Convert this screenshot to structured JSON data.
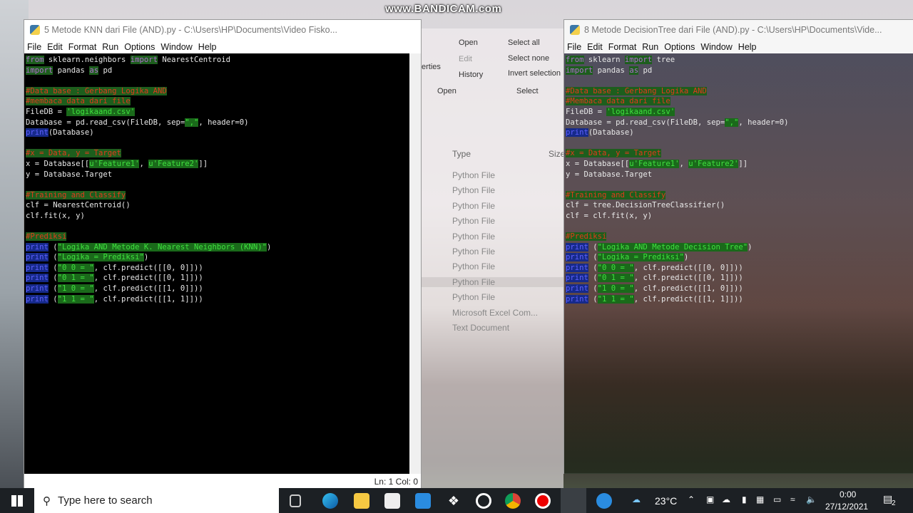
{
  "watermark": "www.BANDICAM.com",
  "left": {
    "title": "5 Metode KNN dari File (AND).py - C:\\Users\\HP\\Documents\\Video Fisko...",
    "menu": [
      "File",
      "Edit",
      "Format",
      "Run",
      "Options",
      "Window",
      "Help"
    ],
    "status": "Ln: 1  Col: 0",
    "code": [
      [
        [
          "kw",
          "from"
        ],
        [
          "p",
          " sklearn.neighbors "
        ],
        [
          "kw",
          "import"
        ],
        [
          "p",
          " NearestCentroid"
        ]
      ],
      [
        [
          "kw",
          "import"
        ],
        [
          "p",
          " pandas "
        ],
        [
          "kw",
          "as"
        ],
        [
          "p",
          " pd"
        ]
      ],
      [],
      [
        [
          "cm",
          "#Data base : Gerbang Logika AND"
        ]
      ],
      [
        [
          "cm",
          "#membaca data dari file"
        ]
      ],
      [
        [
          "p",
          "FileDB = "
        ],
        [
          "str",
          "'logikaand.csv'"
        ]
      ],
      [
        [
          "p",
          "Database = pd.read_csv(FileDB, sep="
        ],
        [
          "str",
          "\",\""
        ],
        [
          "p",
          ", header=0)"
        ]
      ],
      [
        [
          "bi",
          "print"
        ],
        [
          "p",
          "(Database)"
        ]
      ],
      [],
      [
        [
          "cm",
          "#x = Data, y = Target"
        ]
      ],
      [
        [
          "p",
          "x = Database[["
        ],
        [
          "str",
          "u'Feature1'"
        ],
        [
          "p",
          ", "
        ],
        [
          "str",
          "u'Feature2'"
        ],
        [
          "p",
          "]]"
        ]
      ],
      [
        [
          "p",
          "y = Database.Target"
        ]
      ],
      [],
      [
        [
          "cm",
          "#Training and Classify"
        ]
      ],
      [
        [
          "p",
          "clf = NearestCentroid()"
        ]
      ],
      [
        [
          "p",
          "clf.fit(x, y)"
        ]
      ],
      [],
      [
        [
          "cm",
          "#Prediksi"
        ]
      ],
      [
        [
          "bi",
          "print"
        ],
        [
          "p",
          " ("
        ],
        [
          "str",
          "\"Logika AND Metode K. Nearest Neighbors (KNN)\""
        ],
        [
          "p",
          ")"
        ]
      ],
      [
        [
          "bi",
          "print"
        ],
        [
          "p",
          " ("
        ],
        [
          "str",
          "\"Logika = Prediksi\""
        ],
        [
          "p",
          ")"
        ]
      ],
      [
        [
          "bi",
          "print"
        ],
        [
          "p",
          " ("
        ],
        [
          "str",
          "\"0 0 = \""
        ],
        [
          "p",
          ", clf.predict([[0, 0]]))"
        ]
      ],
      [
        [
          "bi",
          "print"
        ],
        [
          "p",
          " ("
        ],
        [
          "str",
          "\"0 1 = \""
        ],
        [
          "p",
          ", clf.predict([[0, 1]]))"
        ]
      ],
      [
        [
          "bi",
          "print"
        ],
        [
          "p",
          " ("
        ],
        [
          "str",
          "\"1 0 = \""
        ],
        [
          "p",
          ", clf.predict([[1, 0]]))"
        ]
      ],
      [
        [
          "bi",
          "print"
        ],
        [
          "p",
          " ("
        ],
        [
          "str",
          "\"1 1 = \""
        ],
        [
          "p",
          ", clf.predict([[1, 1]]))"
        ]
      ]
    ]
  },
  "right": {
    "title": "8 Metode DecisionTree dari File (AND).py - C:\\Users\\HP\\Documents\\Vide...",
    "menu": [
      "File",
      "Edit",
      "Format",
      "Run",
      "Options",
      "Window",
      "Help"
    ],
    "code": [
      [
        [
          "kw",
          "from"
        ],
        [
          "p",
          " sklearn "
        ],
        [
          "kw",
          "import"
        ],
        [
          "p",
          " tree"
        ]
      ],
      [
        [
          "kw",
          "import"
        ],
        [
          "p",
          " pandas "
        ],
        [
          "kw",
          "as"
        ],
        [
          "p",
          " pd"
        ]
      ],
      [],
      [
        [
          "cm",
          "#Data base : Gerbang Logika AND"
        ]
      ],
      [
        [
          "cm",
          "#Membaca data dari file"
        ]
      ],
      [
        [
          "p",
          "FileDB = "
        ],
        [
          "str",
          "'logikaand.csv'"
        ]
      ],
      [
        [
          "p",
          "Database = pd.read_csv(FileDB, sep="
        ],
        [
          "str",
          "\",\""
        ],
        [
          "p",
          ", header=0)"
        ]
      ],
      [
        [
          "bi",
          "print"
        ],
        [
          "p",
          "(Database)"
        ]
      ],
      [],
      [
        [
          "cm",
          "#x = Data, y = Target"
        ]
      ],
      [
        [
          "p",
          "x = Database[["
        ],
        [
          "str",
          "u'Feature1'"
        ],
        [
          "p",
          ", "
        ],
        [
          "str",
          "u'Feature2'"
        ],
        [
          "p",
          "]]"
        ]
      ],
      [
        [
          "p",
          "y = Database.Target"
        ]
      ],
      [],
      [
        [
          "cm",
          "#Training and Classify"
        ]
      ],
      [
        [
          "p",
          "clf = tree.DecisionTreeClassifier()"
        ]
      ],
      [
        [
          "p",
          "clf = clf.fit(x, y)"
        ]
      ],
      [],
      [
        [
          "cm",
          "#Prediksi"
        ]
      ],
      [
        [
          "bi",
          "print"
        ],
        [
          "p",
          " ("
        ],
        [
          "str",
          "\"Logika AND Metode Decision Tree\""
        ],
        [
          "p",
          ")"
        ]
      ],
      [
        [
          "bi",
          "print"
        ],
        [
          "p",
          " ("
        ],
        [
          "str",
          "\"Logika = Prediksi\""
        ],
        [
          "p",
          ")"
        ]
      ],
      [
        [
          "bi",
          "print"
        ],
        [
          "p",
          " ("
        ],
        [
          "str",
          "\"0 0 = \""
        ],
        [
          "p",
          ", clf.predict([[0, 0]]))"
        ]
      ],
      [
        [
          "bi",
          "print"
        ],
        [
          "p",
          " ("
        ],
        [
          "str",
          "\"0 1 = \""
        ],
        [
          "p",
          ", clf.predict([[0, 1]]))"
        ]
      ],
      [
        [
          "bi",
          "print"
        ],
        [
          "p",
          " ("
        ],
        [
          "str",
          "\"1 0 = \""
        ],
        [
          "p",
          ", clf.predict([[1, 0]]))"
        ]
      ],
      [
        [
          "bi",
          "print"
        ],
        [
          "p",
          " ("
        ],
        [
          "str",
          "\"1 1 = \""
        ],
        [
          "p",
          ", clf.predict([[1, 1]]))"
        ]
      ]
    ]
  },
  "explorer": {
    "ribbon": {
      "properties": "erties",
      "open": "Open",
      "edit": "Edit",
      "history": "History",
      "group_open": "Open",
      "select_all": "Select all",
      "select_none": "Select none",
      "invert": "Invert selection",
      "group_select": "Select"
    },
    "col_type": "Type",
    "col_size": "Size",
    "types": [
      "Python File",
      "Python File",
      "Python File",
      "Python File",
      "Python File",
      "Python File",
      "Python File",
      "Python File",
      "Python File",
      "Microsoft Excel Com...",
      "Text Document"
    ]
  },
  "taskbar": {
    "search_placeholder": "Type here to search",
    "weather": "23°C",
    "time": "0:00",
    "date": "27/12/2021",
    "notifications": "2"
  }
}
